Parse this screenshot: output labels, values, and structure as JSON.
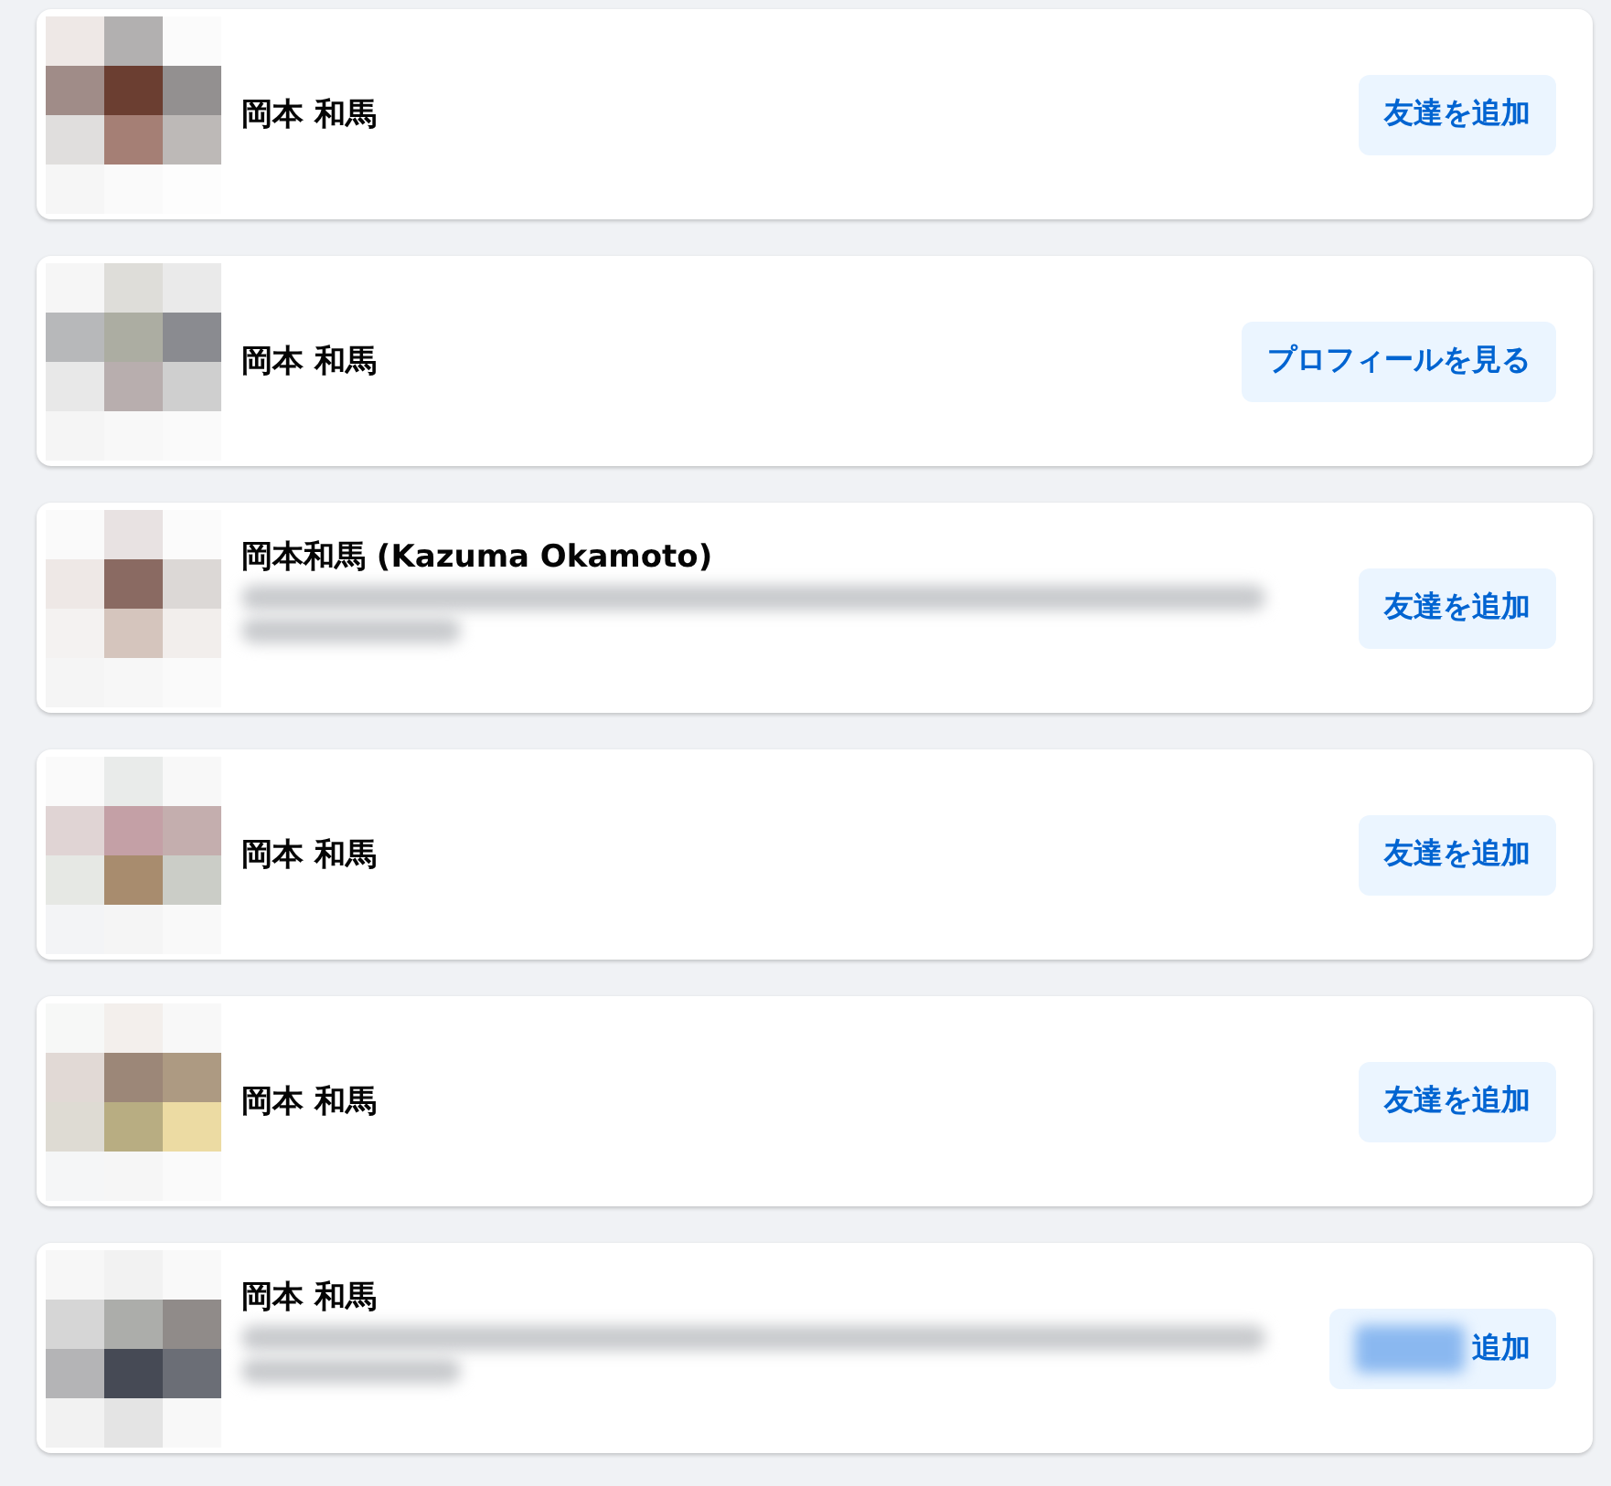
{
  "results": [
    {
      "kind": "plain",
      "name": "岡本 和馬",
      "button": "友達を追加"
    },
    {
      "kind": "plain",
      "name": "岡本 和馬",
      "button": "プロフィールを見る"
    },
    {
      "kind": "details",
      "name": "岡本和馬 (Kazuma Okamoto)",
      "button": "友達を追加"
    },
    {
      "kind": "plain",
      "name": "岡本 和馬",
      "button": "友達を追加"
    },
    {
      "kind": "plain",
      "name": "岡本 和馬",
      "button": "友達を追加"
    },
    {
      "kind": "details",
      "name": "岡本 和馬",
      "button": "追加"
    }
  ]
}
